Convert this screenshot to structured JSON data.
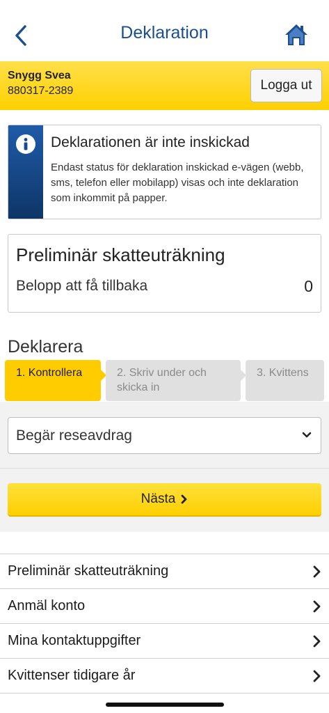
{
  "header": {
    "title": "Deklaration",
    "back_icon": "chevron-left-icon",
    "home_icon": "home-icon",
    "accent_color": "#1b4f8f"
  },
  "user": {
    "name": "Snygg Svea",
    "personal_number": "880317-2389",
    "logout_label": "Logga ut",
    "bar_color": "#ffd000"
  },
  "info_box": {
    "icon": "info-icon",
    "title": "Deklarationen är inte inskickad",
    "text": "Endast status för deklaration inskickad e-vägen (webb, sms, telefon eller mobilapp) visas och inte deklaration som inkommit på papper."
  },
  "preliminary": {
    "title": "Preliminär skatteuträkning",
    "label": "Belopp att få tillbaka",
    "value": "0"
  },
  "declare": {
    "heading": "Deklarera",
    "steps": [
      {
        "label": "1. Kontrollera",
        "active": true
      },
      {
        "label": "2. Skriv under och skicka in",
        "active": false
      },
      {
        "label": "3. Kvittens",
        "active": false
      }
    ],
    "select_value": "Begär reseavdrag",
    "next_label": "Nästa"
  },
  "links": [
    {
      "label": "Preliminär skatteuträkning"
    },
    {
      "label": "Anmäl konto"
    },
    {
      "label": "Mina kontaktuppgifter"
    },
    {
      "label": "Kvittenser tidigare år"
    }
  ]
}
